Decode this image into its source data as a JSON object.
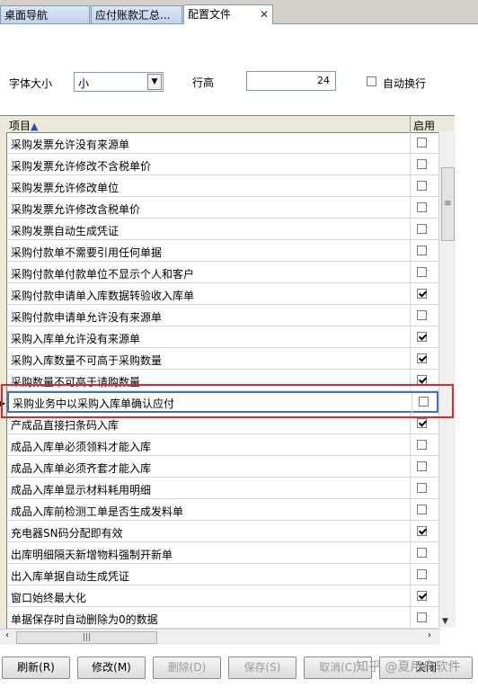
{
  "tabs": [
    {
      "label": "桌面导航"
    },
    {
      "label": "应付账款汇总..."
    },
    {
      "label": "配置文件"
    }
  ],
  "settings": {
    "font_size_label": "字体大小",
    "font_size_value": "小",
    "line_height_label": "行高",
    "line_height_value": "24",
    "auto_wrap_label": "自动换行",
    "auto_wrap_checked": false
  },
  "grid": {
    "col_item": "项目",
    "col_enabled": "启用",
    "rows": [
      {
        "label": "采购发票允许没有来源单",
        "enabled": false
      },
      {
        "label": "采购发票允许修改不含税单价",
        "enabled": false
      },
      {
        "label": "采购发票允许修改单位",
        "enabled": false
      },
      {
        "label": "采购发票允许修改含税单价",
        "enabled": false
      },
      {
        "label": "采购发票自动生成凭证",
        "enabled": false
      },
      {
        "label": "采购付款单不需要引用任何单据",
        "enabled": false
      },
      {
        "label": "采购付款单付款单位不显示个人和客户",
        "enabled": false
      },
      {
        "label": "采购付款申请单入库数据转验收入库单",
        "enabled": true
      },
      {
        "label": "采购付款申请单允许没有来源单",
        "enabled": false
      },
      {
        "label": "采购入库单允许没有来源单",
        "enabled": true
      },
      {
        "label": "采购入库数量不可高于采购数量",
        "enabled": true
      },
      {
        "label": "采购数量不可高于请购数量",
        "enabled": true
      },
      {
        "label": "采购业务中以采购入库单确认应付",
        "enabled": false,
        "selected": true
      },
      {
        "label": "产成品直接扫条码入库",
        "enabled": true
      },
      {
        "label": "成品入库单必须领料才能入库",
        "enabled": false
      },
      {
        "label": "成品入库单必须齐套才能入库",
        "enabled": false
      },
      {
        "label": "成品入库单显示材料耗用明细",
        "enabled": false
      },
      {
        "label": "成品入库前检测工单是否生成发料单",
        "enabled": false
      },
      {
        "label": "充电器SN码分配即有效",
        "enabled": true
      },
      {
        "label": "出库明细隔天新增物料强制开新单",
        "enabled": false
      },
      {
        "label": "出入库单据自动生成凭证",
        "enabled": false
      },
      {
        "label": "窗口始终最大化",
        "enabled": true
      },
      {
        "label": "单据保存时自动删除为0的数据",
        "enabled": false
      }
    ]
  },
  "buttons": {
    "refresh": "刷新(R)",
    "modify": "修改(M)",
    "delete": "删除(D)",
    "save": "保存(S)",
    "cancel": "取消(C)",
    "close": "关闭"
  },
  "watermark": "知乎 @夏用鸟软件"
}
